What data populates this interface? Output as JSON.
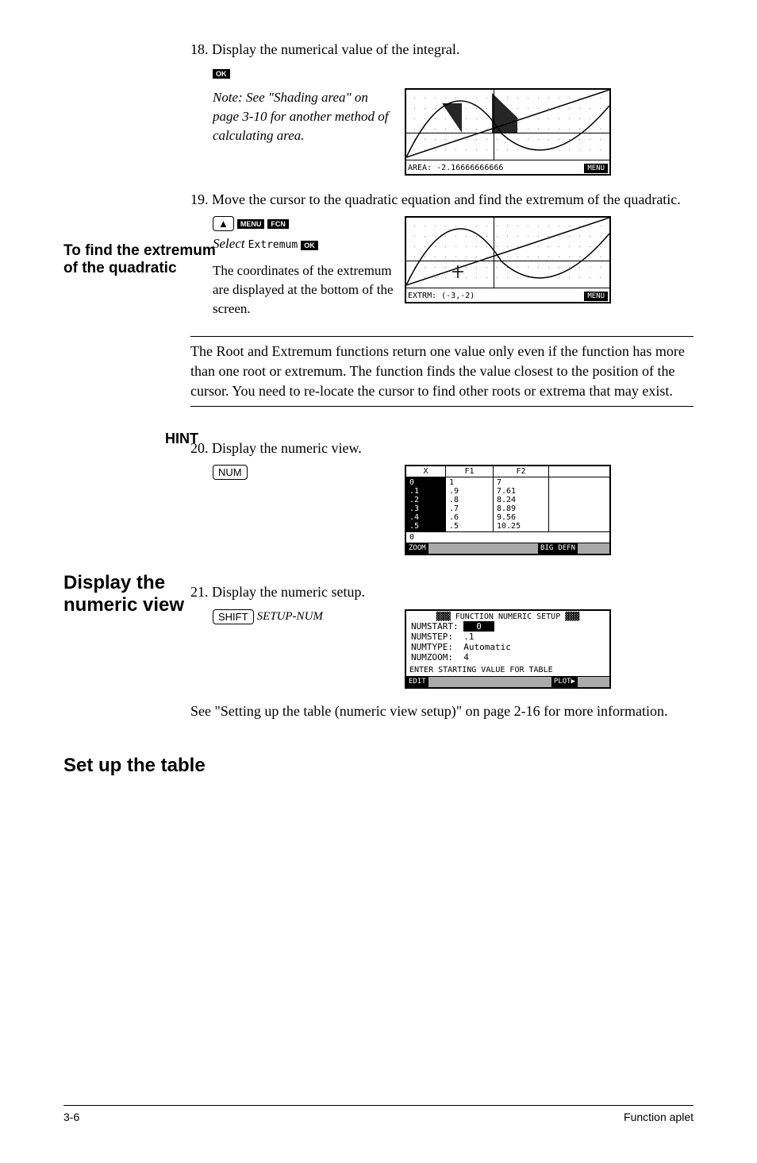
{
  "step18": {
    "text": "18. Display the numerical value of the integral.",
    "key": "OK",
    "note": "Note: See \"Shading area\" on page 3-10 for another method of calculating area.",
    "screen_status": "AREA: -2.16666666666",
    "screen_menu": "MENU"
  },
  "heading_extremum": "To find the extremum of the quadratic",
  "step19": {
    "text": "19. Move the cursor to the quadratic equation and find the extremum of the quadratic.",
    "key_up": "▲",
    "key_menu": "MENU",
    "key_fcn": "FCN",
    "select_text": "Select",
    "select_mono": "Extremum",
    "key_ok": "OK",
    "desc": "The coordinates of the extremum are displayed at the bottom of the screen.",
    "screen_status": "EXTRM: (-3,-2)",
    "screen_menu": "MENU"
  },
  "heading_hint": "HINT",
  "hint_text": "The Root and Extremum functions return one value only even if the function has more than one root or extremum. The function finds the value closest to the position of the cursor. You need to re-locate the cursor to find other roots or extrema that may exist.",
  "heading_display": "Display the numeric view",
  "step20": {
    "text": "20. Display the numeric view.",
    "key": "NUM",
    "table": {
      "headers": [
        "X",
        "F1",
        "F2"
      ],
      "col_x": [
        "0",
        ".1",
        ".2",
        ".3",
        ".4",
        ".5"
      ],
      "col_f1": [
        "1",
        ".9",
        ".8",
        ".7",
        ".6",
        ".5"
      ],
      "col_f2": [
        "7",
        "7.61",
        "8.24",
        "8.89",
        "9.56",
        "10.25"
      ],
      "footer_val": "0",
      "footer_btns": [
        "ZOOM",
        "",
        "",
        "BIG",
        "DEFN",
        ""
      ]
    }
  },
  "heading_setup": "Set up the table",
  "step21": {
    "text": "21. Display the numeric setup.",
    "key1": "SHIFT",
    "key2": "SETUP-NUM",
    "setup": {
      "title": "FUNCTION NUMERIC SETUP",
      "numstart_label": "NUMSTART:",
      "numstart_val": "0",
      "numstep_label": "NUMSTEP:",
      "numstep_val": ".1",
      "numtype_label": "NUMTYPE:",
      "numtype_val": "Automatic",
      "numzoom_label": "NUMZOOM:",
      "numzoom_val": "4",
      "prompt": "ENTER STARTING VALUE FOR TABLE",
      "footer_btns": [
        "EDIT",
        "",
        "",
        "",
        "PLOT▶",
        ""
      ]
    },
    "after_text": "See \"Setting up the table (numeric view setup)\" on page 2-16 for more information."
  },
  "footer": {
    "page": "3-6",
    "section": "Function aplet"
  }
}
